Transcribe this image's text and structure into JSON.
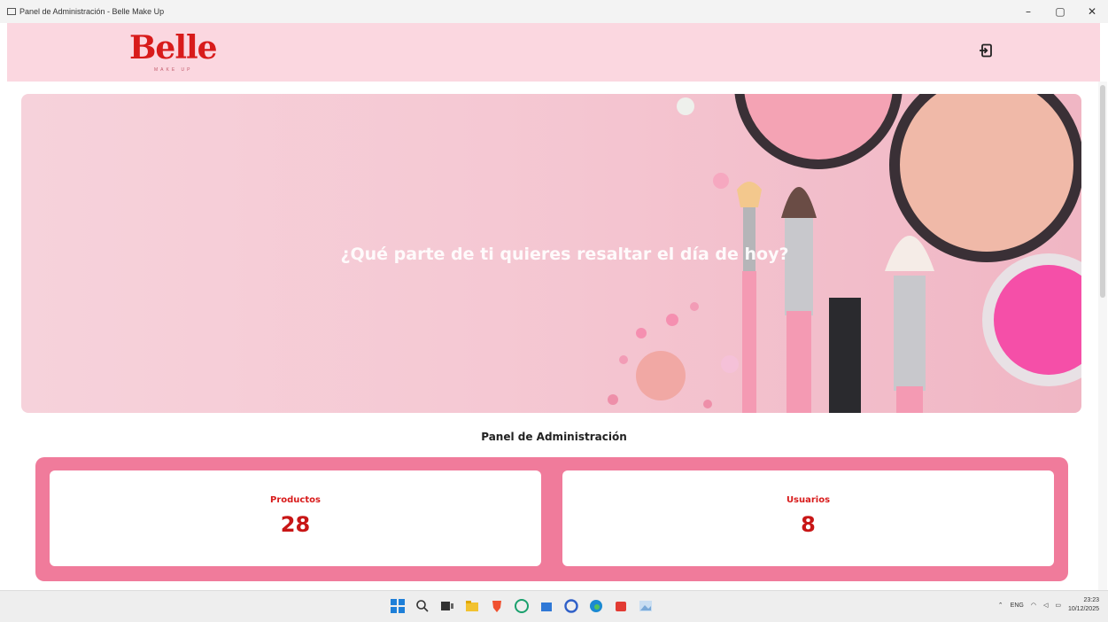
{
  "window": {
    "title": "Panel de Administración - Belle Make Up",
    "minimize": "–",
    "maximize": "▢",
    "close": "✕"
  },
  "header": {
    "logo_text": "Belle",
    "logo_subtext": "MAKE UP"
  },
  "hero": {
    "text": "¿Qué parte de ti quieres resaltar el día de hoy?"
  },
  "panel": {
    "title": "Panel de Administración",
    "stats": [
      {
        "label": "Productos",
        "value": "28"
      },
      {
        "label": "Usuarios",
        "value": "8"
      }
    ]
  },
  "taskbar": {
    "language": "ENG",
    "time": "23:23",
    "date": "10/12/2025"
  },
  "colors": {
    "brand_red": "#d81b1b",
    "header_pink": "#fbd7e0",
    "panel_pink": "#f07b9b"
  }
}
